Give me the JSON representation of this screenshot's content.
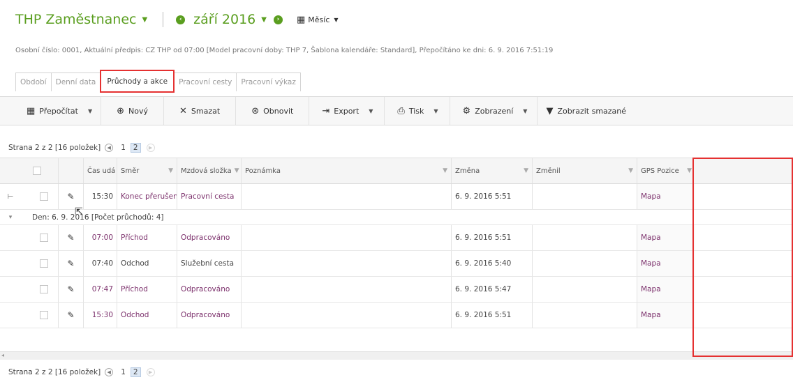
{
  "header": {
    "title": "THP Zaměstnanec",
    "period": "září 2016",
    "view_label": "Měsíc"
  },
  "info_line": "Osobní číslo: 0001, Aktuální předpis: CZ THP od 07:00 [Model pracovní doby: THP 7, Šablona kalendáře: Standard], Přepočítáno ke dni: 6. 9. 2016 7:51:19",
  "tabs": [
    {
      "label": "Období",
      "active": false
    },
    {
      "label": "Denní data",
      "active": false
    },
    {
      "label": "Průchody a akce",
      "active": true
    },
    {
      "label": "Pracovní cesty",
      "active": false
    },
    {
      "label": "Pracovní výkaz",
      "active": false
    }
  ],
  "toolbar": {
    "recalc": "Přepočítat",
    "new": "Nový",
    "delete": "Smazat",
    "refresh": "Obnovit",
    "export": "Export",
    "print": "Tisk",
    "view": "Zobrazení",
    "show_deleted": "Zobrazit smazané"
  },
  "pager": {
    "summary": "Strana 2 z 2 [16 položek]",
    "pages": [
      "1",
      "2"
    ],
    "current": "2"
  },
  "columns": {
    "time": "Čas udá",
    "direction": "Směr",
    "wage": "Mzdová složka",
    "note": "Poznámka",
    "changed": "Změna",
    "changed_by": "Změnil",
    "gps": "GPS Pozice"
  },
  "rows_before_group": [
    {
      "time": "15:30",
      "direction": "Konec přerušení",
      "wage": "Pracovní cesta",
      "note": "",
      "changed": "6. 9. 2016 5:51",
      "changed_by": "",
      "gps": "Mapa"
    }
  ],
  "group": {
    "label": "Den: 6. 9. 2016 [Počet průchodů: 4]"
  },
  "rows": [
    {
      "time": "07:00",
      "direction": "Příchod",
      "wage": "Odpracováno",
      "note": "",
      "changed": "6. 9. 2016 5:51",
      "changed_by": "",
      "gps": "Mapa"
    },
    {
      "time": "07:40",
      "direction": "Odchod",
      "wage": "Služební cesta",
      "note": "",
      "changed": "6. 9. 2016 5:40",
      "changed_by": "",
      "gps": "Mapa"
    },
    {
      "time": "07:47",
      "direction": "Příchod",
      "wage": "Odpracováno",
      "note": "",
      "changed": "6. 9. 2016 5:47",
      "changed_by": "",
      "gps": "Mapa"
    },
    {
      "time": "15:30",
      "direction": "Odchod",
      "wage": "Odpracováno",
      "note": "",
      "changed": "6. 9. 2016 5:51",
      "changed_by": "",
      "gps": "Mapa"
    }
  ],
  "colors": {
    "accent": "#5a9e1f",
    "highlight": "#e53131",
    "purple_text": "#7b2f6b"
  }
}
